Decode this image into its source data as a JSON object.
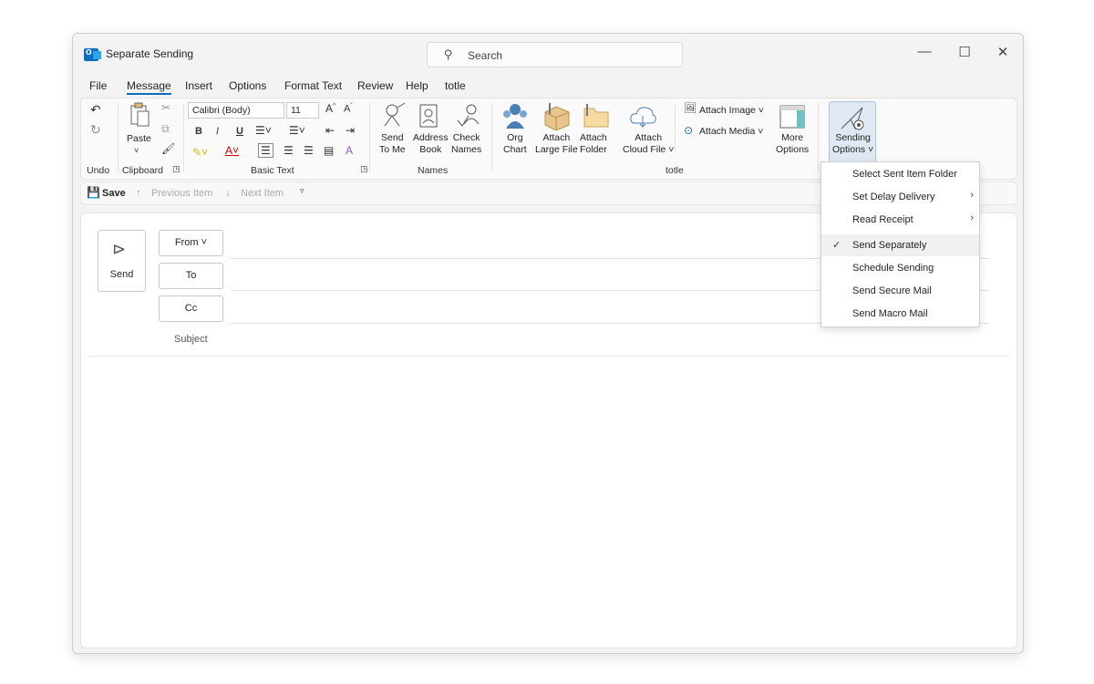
{
  "window": {
    "title": "Separate Sending",
    "search_placeholder": "Search"
  },
  "menu": [
    "File",
    "Message",
    "Insert",
    "Options",
    "Format Text",
    "Review",
    "Help",
    "totle"
  ],
  "ribbon": {
    "undo_label": "Undo",
    "clipboard": {
      "paste": "Paste",
      "group": "Clipboard"
    },
    "basic_text": {
      "font": "Calibri (Body)",
      "size": "11",
      "group": "Basic Text"
    },
    "names": {
      "send_to_me": [
        "Send",
        "To Me"
      ],
      "address_book": [
        "Address",
        "Book"
      ],
      "check_names": [
        "Check",
        "Names"
      ],
      "group": "Names"
    },
    "totle": {
      "org_chart": [
        "Org",
        "Chart"
      ],
      "attach_large": [
        "Attach",
        "Large File"
      ],
      "attach_folder": [
        "Attach",
        "Folder"
      ],
      "attach_cloud": [
        "Attach",
        "Cloud File ˅"
      ],
      "attach_image": "Attach Image ˅",
      "attach_media": "Attach Media ˅",
      "more_options": [
        "More",
        "Options"
      ],
      "group": "totle"
    },
    "sending_options": [
      "Sending",
      "Options ˅"
    ]
  },
  "qat": {
    "save": "Save",
    "previous": "Previous Item",
    "next": "Next Item"
  },
  "compose": {
    "send": "Send",
    "from": "From ˅",
    "to": "To",
    "cc": "Cc",
    "subject": "Subject"
  },
  "dropdown": {
    "items": [
      {
        "label": "Select Sent Item Folder",
        "submenu": false,
        "checked": false
      },
      {
        "label": "Set Delay Delivery",
        "submenu": true,
        "checked": false
      },
      {
        "label": "Read Receipt",
        "submenu": true,
        "checked": false
      },
      {
        "label": "Send Separately",
        "submenu": false,
        "checked": true
      },
      {
        "label": "Schedule Sending",
        "submenu": false,
        "checked": false
      },
      {
        "label": "Send Secure Mail",
        "submenu": false,
        "checked": false
      },
      {
        "label": "Send Macro Mail",
        "submenu": false,
        "checked": false
      }
    ]
  },
  "colors": {
    "accent": "#0f6cbd",
    "highlight": "#dfe8f3"
  }
}
